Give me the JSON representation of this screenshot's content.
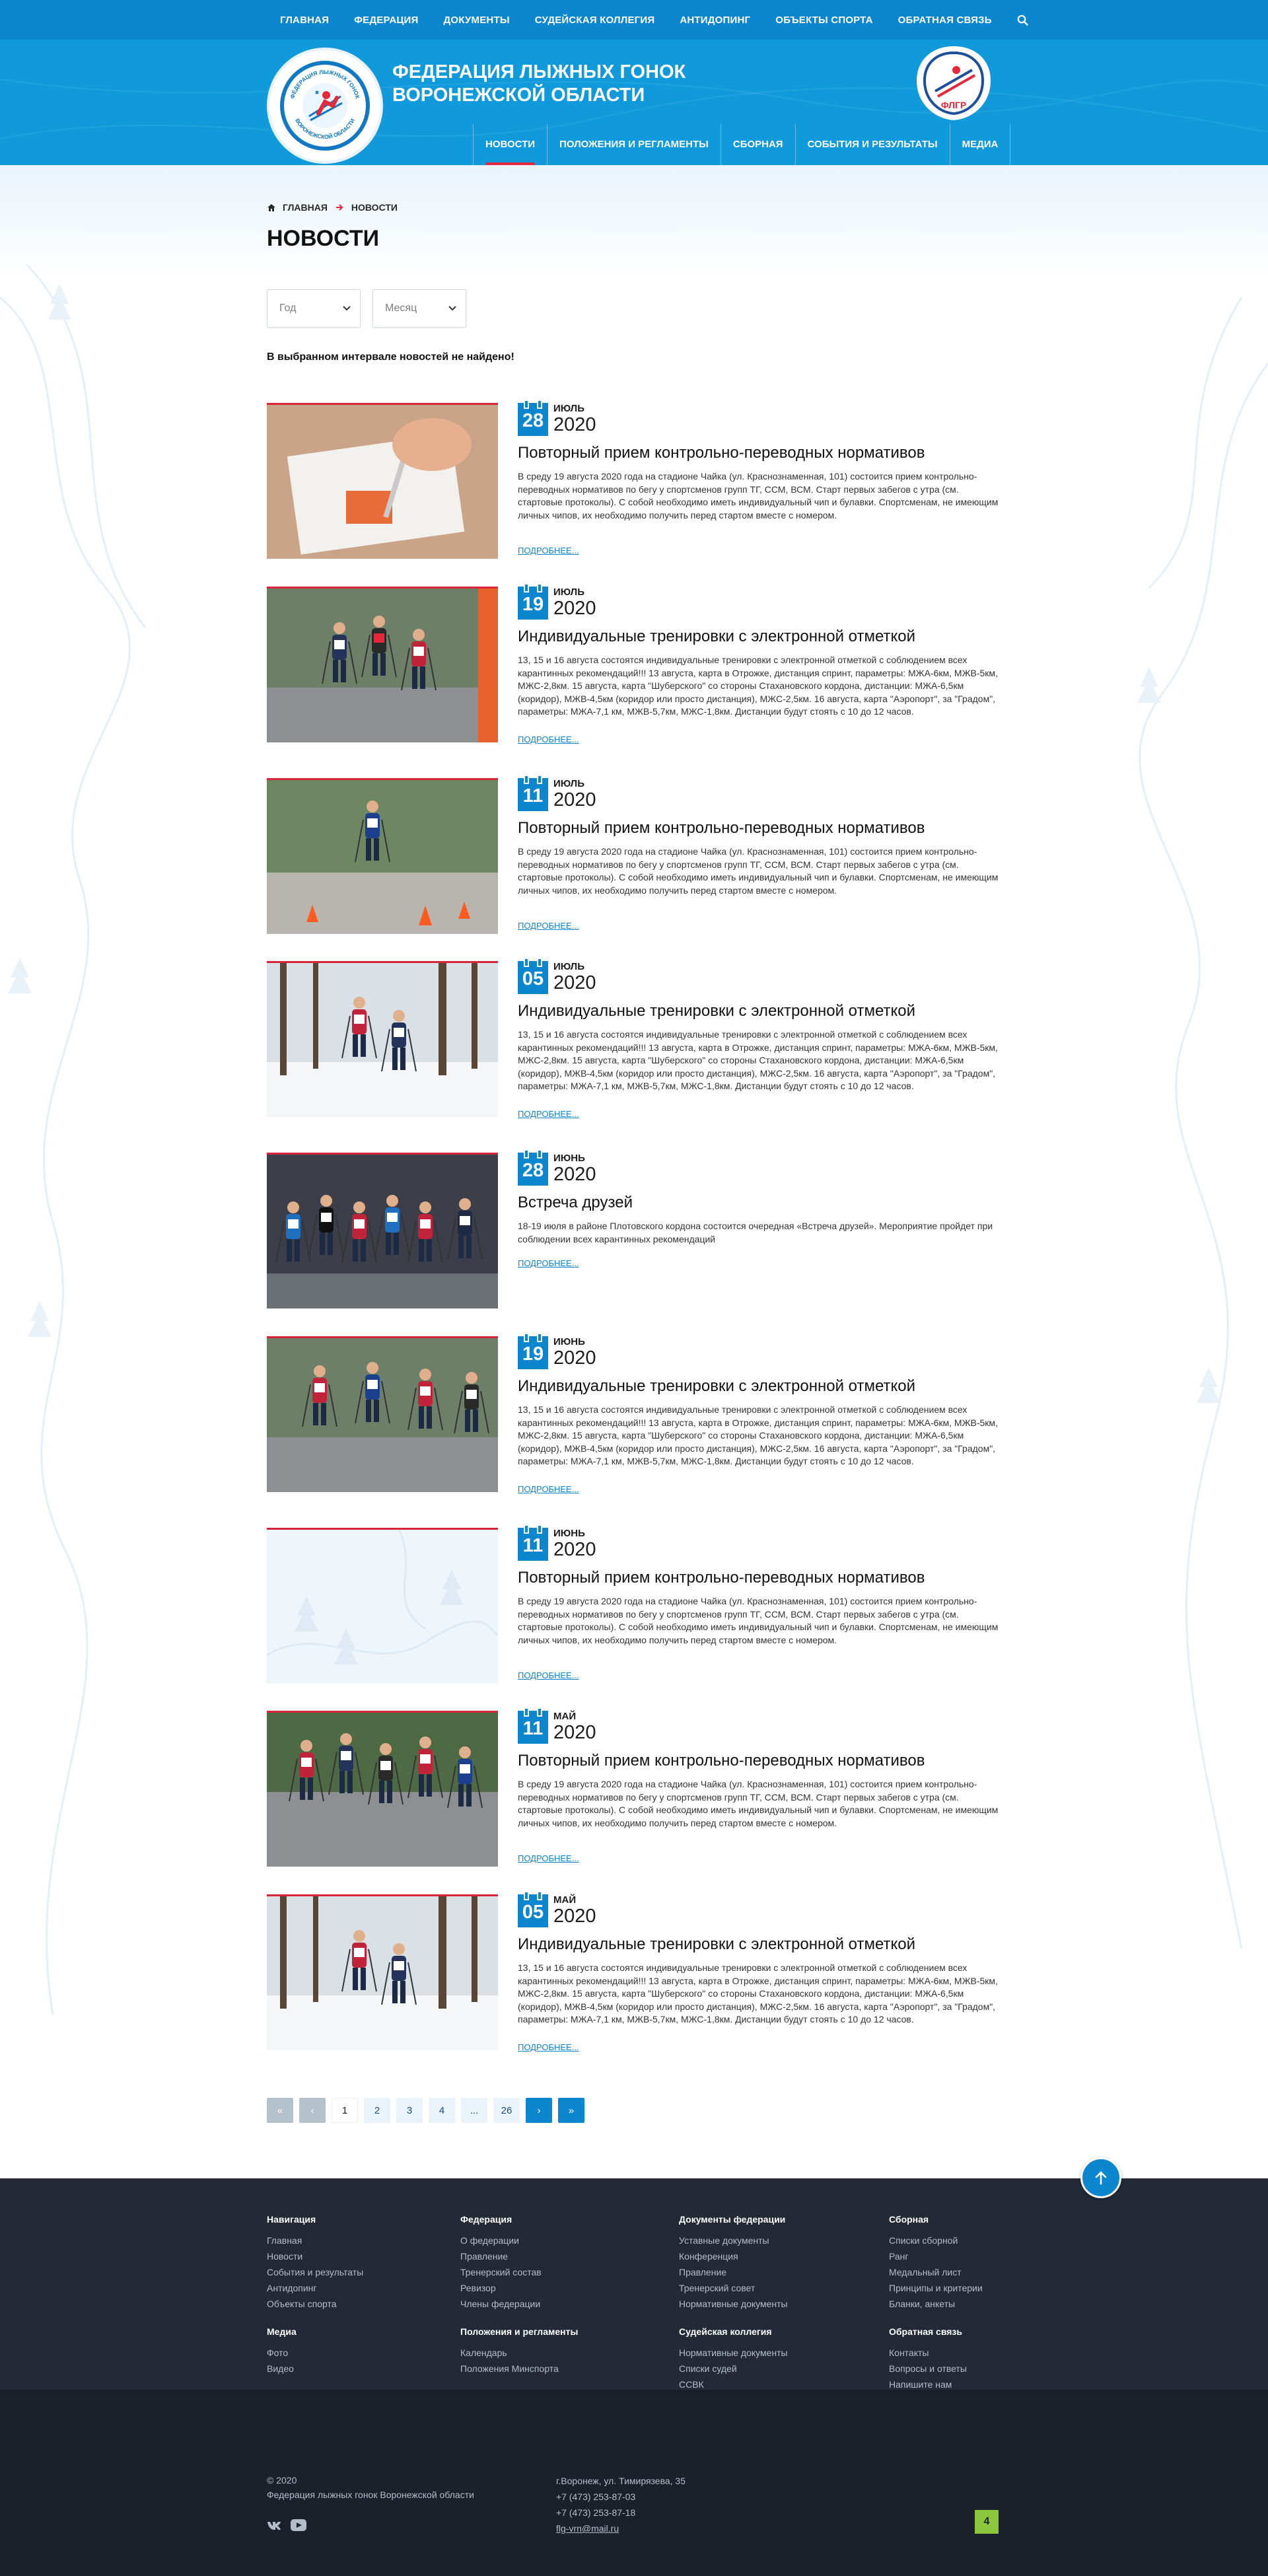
{
  "topnav": {
    "items": [
      "ГЛАВНАЯ",
      "ФЕДЕРАЦИЯ",
      "ДОКУМЕНТЫ",
      "СУДЕЙСКАЯ КОЛЛЕГИЯ",
      "АНТИДОПИНГ",
      "ОБЪЕКТЫ СПОРТА",
      "ОБРАТНАЯ СВЯЗЬ"
    ],
    "search_icon": "search-icon"
  },
  "header": {
    "title_line1": "ФЕДЕРАЦИЯ ЛЫЖНЫХ ГОНОК",
    "title_line2": "ВОРОНЕЖСКОЙ ОБЛАСТИ",
    "logo_ring_top": "ФЕДЕРАЦИЯ ЛЫЖНЫХ ГОНОК",
    "logo_ring_bottom": "ВОРОНЕЖСКОЙ ОБЛАСТИ",
    "fed_logo_text": "ФЛГР"
  },
  "mainnav": {
    "items": [
      "НОВОСТИ",
      "ПОЛОЖЕНИЯ И РЕГЛАМЕНТЫ",
      "СБОРНАЯ",
      "СОБЫТИЯ И РЕЗУЛЬТАТЫ",
      "МЕДИА"
    ],
    "active_index": 0
  },
  "breadcrumb": {
    "home_icon": "home-icon",
    "home": "ГЛАВНАЯ",
    "current": "НОВОСТИ"
  },
  "page": {
    "title": "НОВОСТИ",
    "filter_year_placeholder": "Год",
    "filter_month_placeholder": "Месяц",
    "empty_message": "В выбранном интервале новостей не найдено!",
    "more_label": "ПОДРОБНЕЕ..."
  },
  "news": [
    {
      "day": "28",
      "month": "ИЮЛЬ",
      "year": "2020",
      "title": "Повторный прием контрольно-переводных нормативов",
      "text": "В среду 19 августа 2020 года на стадионе Чайка (ул. Краснознаменная, 101) состоится прием контрольно-переводных нормативов по бегу у спортсменов групп ТГ, ССМ, ВСМ. Старт первых забегов с утра (см. стартовые протоколы). С собой необходимо иметь индивидуальный чип и булавки. Спортсменам, не имеющим личных чипов, их необходимо получить перед стартом вместе с номером.",
      "image": "hand-writing"
    },
    {
      "day": "19",
      "month": "ИЮЛЬ",
      "year": "2020",
      "title": "Индивидуальные тренировки с электронной отметкой",
      "text": "13, 15 и 16 августа состоятся индивидуальные тренировки с электронной отметкой с соблюдением всех карантинных рекомендаций!!! 13 августа, карта в Отрожке, дистанция спринт, параметры: МЖА-6км, МЖВ-5км, МЖС-2,8км. 15 августа, карта \"Шуберского\" со стороны Стахановского кордона, дистанции: МЖА-6,5км (коридор), МЖВ-4,5км (коридор или просто дистанция), МЖС-2,5км. 16 августа, карта \"Аэропорт\", за \"Градом\", параметры: МЖА-7,1 км, МЖВ-5,7км, МЖС-1,8км. Дистанции будут стоять с 10 до 12 часов.",
      "image": "rollerski-group"
    },
    {
      "day": "11",
      "month": "ИЮЛЬ",
      "year": "2020",
      "title": "Повторный прием контрольно-переводных нормативов",
      "text": "В среду 19 августа 2020 года на стадионе Чайка (ул. Краснознаменная, 101) состоится прием контрольно-переводных нормативов по бегу у спортсменов групп ТГ, ССМ, ВСМ. Старт первых забегов с утра (см. стартовые протоколы). С собой необходимо иметь индивидуальный чип и булавки. Спортсменам, не имеющим личных чипов, их необходимо получить перед стартом вместе с номером.",
      "image": "rollerski-cones"
    },
    {
      "day": "05",
      "month": "ИЮЛЬ",
      "year": "2020",
      "title": "Индивидуальные тренировки с электронной отметкой",
      "text": "13, 15 и 16 августа состоятся индивидуальные тренировки с электронной отметкой с соблюдением всех карантинных рекомендаций!!! 13 августа, карта в Отрожке, дистанция спринт, параметры: МЖА-6км, МЖВ-5км, МЖС-2,8км. 15 августа, карта \"Шуберского\" со стороны Стахановского кордона, дистанции: МЖА-6,5км (коридор), МЖВ-4,5км (коридор или просто дистанция), МЖС-2,5км. 16 августа, карта \"Аэропорт\", за \"Градом\", параметры: МЖА-7,1 км, МЖВ-5,7км, МЖС-1,8км. Дистанции будут стоять с 10 до 12 часов.",
      "image": "snow-forest"
    },
    {
      "day": "28",
      "month": "ИЮНЬ",
      "year": "2020",
      "title": "Встреча друзей",
      "text": "18-19 июля  в районе Плотовского кордона состоится очередная «Встреча друзей». Мероприятие пройдет при соблюдении всех карантинных рекомендаций",
      "image": "team-photo"
    },
    {
      "day": "19",
      "month": "ИЮНЬ",
      "year": "2020",
      "title": "Индивидуальные тренировки с электронной отметкой",
      "text": "13, 15 и 16 августа состоятся индивидуальные тренировки с электронной отметкой с соблюдением всех карантинных рекомендаций!!! 13 августа, карта в Отрожке, дистанция спринт, параметры: МЖА-6км, МЖВ-5км, МЖС-2,8км. 15 августа, карта \"Шуберского\" со стороны Стахановского кордона, дистанции: МЖА-6,5км (коридор), МЖВ-4,5км (коридор или просто дистанция), МЖС-2,5км. 16 августа, карта \"Аэропорт\", за \"Градом\", параметры: МЖА-7,1 км, МЖВ-5,7км, МЖС-1,8км. Дистанции будут стоять с 10 до 12 часов.",
      "image": "rollerski-women"
    },
    {
      "day": "11",
      "month": "ИЮНЬ",
      "year": "2020",
      "title": "Повторный прием контрольно-переводных нормативов",
      "text": "В среду 19 августа 2020 года на стадионе Чайка (ул. Краснознаменная, 101) состоится прием контрольно-переводных нормативов по бегу у спортсменов групп ТГ, ССМ, ВСМ. Старт первых забегов с утра (см. стартовые протоколы). С собой необходимо иметь индивидуальный чип и булавки. Спортсменам, не имеющим личных чипов, их необходимо получить перед стартом вместе с номером.",
      "image": "placeholder"
    },
    {
      "day": "11",
      "month": "МАЙ",
      "year": "2020",
      "title": "Повторный прием контрольно-переводных нормативов",
      "text": "В среду 19 августа 2020 года на стадионе Чайка (ул. Краснознаменная, 101) состоится прием контрольно-переводных нормативов по бегу у спортсменов групп ТГ, ССМ, ВСМ. Старт первых забегов с утра (см. стартовые протоколы). С собой необходимо иметь индивидуальный чип и булавки. Спортсменам, не имеющим личных чипов, их необходимо получить перед стартом вместе с номером.",
      "image": "rollerski-pack"
    },
    {
      "day": "05",
      "month": "МАЙ",
      "year": "2020",
      "title": "Индивидуальные тренировки с электронной отметкой",
      "text": "13, 15 и 16 августа состоятся индивидуальные тренировки с электронной отметкой с соблюдением всех карантинных рекомендаций!!! 13 августа, карта в Отрожке, дистанция спринт, параметры: МЖА-6км, МЖВ-5км, МЖС-2,8км. 15 августа, карта \"Шуберского\" со стороны Стахановского кордона, дистанции: МЖА-6,5км (коридор), МЖВ-4,5км (коридор или просто дистанция), МЖС-2,5км. 16 августа, карта \"Аэропорт\", за \"Градом\", параметры: МЖА-7,1 км, МЖВ-5,7км, МЖС-1,8км. Дистанции будут стоять с 10 до 12 часов.",
      "image": "snow-forest"
    }
  ],
  "pagination": {
    "first": "«",
    "prev": "‹",
    "pages": [
      "1",
      "2",
      "3",
      "4",
      "...",
      "26"
    ],
    "current": "1",
    "next": "›",
    "last": "»"
  },
  "footer": {
    "columns": [
      {
        "heading": "Навигация",
        "links": [
          "Главная",
          "Новости",
          "События и результаты",
          "Антидопинг",
          "Объекты спорта"
        ]
      },
      {
        "heading": "Федерация",
        "links": [
          "О федерации",
          "Правление",
          "Тренерский состав",
          "Ревизор",
          "Члены федерации"
        ]
      },
      {
        "heading": "Документы федерации",
        "links": [
          "Уставные документы",
          "Конференция",
          "Правление",
          "Тренерский совет",
          "Нормативные документы"
        ]
      },
      {
        "heading": "Сборная",
        "links": [
          "Списки сборной",
          "Ранг",
          "Медальный лист",
          "Принципы и критерии",
          "Бланки, анкеты"
        ]
      },
      {
        "heading": "Медиа",
        "links": [
          "Фото",
          "Видео"
        ]
      },
      {
        "heading": "Положения и регламенты",
        "links": [
          "Календарь",
          "Положения Минспорта"
        ]
      },
      {
        "heading": "Судейская коллегия",
        "links": [
          "Нормативные документы",
          "Списки судей",
          "ССВК"
        ]
      },
      {
        "heading": "Обратная связь",
        "links": [
          "Контакты",
          "Вопросы и ответы",
          "Напишите нам"
        ]
      }
    ],
    "copyright_year": "© 2020",
    "copyright_text": "Федерация лыжных гонок Воронежской области",
    "address": "г.Воронеж, ул. Тимирязева, 35",
    "phone1": "+7 (473) 253-87-03",
    "phone2": "+7 (473) 253-87-18",
    "email": "flg-vrn@mail.ru",
    "social_icons": [
      "vk-icon",
      "youtube-icon"
    ],
    "counter_label": "4",
    "up_icon": "arrow-up-icon"
  },
  "colors": {
    "primary": "#0b86cf",
    "header": "#109adc",
    "accent": "#e5293b",
    "footer": "#232a36",
    "footer_bottom": "#1b212b"
  }
}
